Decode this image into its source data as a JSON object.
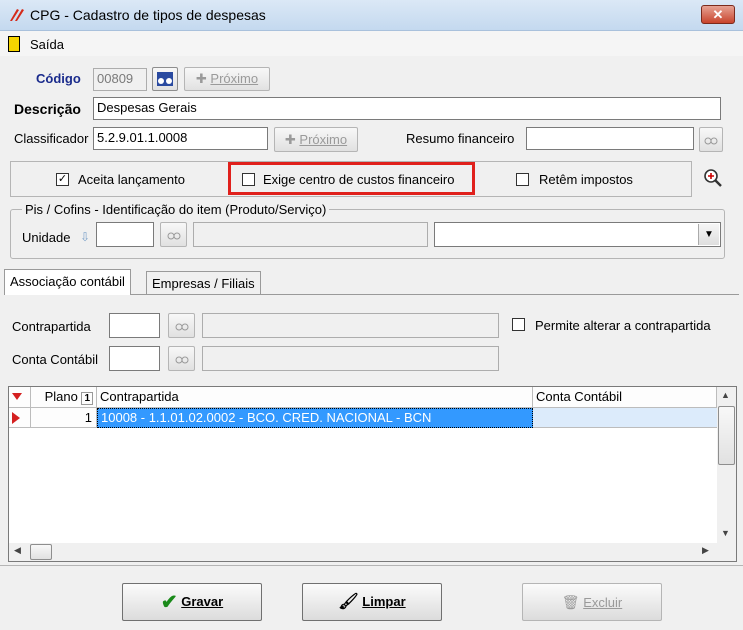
{
  "window": {
    "title": "CPG - Cadastro de tipos de despesas",
    "close_label": "✕"
  },
  "menu": {
    "saida": "Saída"
  },
  "form": {
    "codigo_label": "Código",
    "codigo_value": "00809",
    "proximo_label": "Próximo",
    "descricao_label": "Descrição",
    "descricao_value": "Despesas Gerais",
    "classificador_label": "Classificador",
    "classificador_value": "5.2.9.01.1.0008",
    "resumo_label": "Resumo financeiro",
    "resumo_value": ""
  },
  "options": {
    "aceita_label": "Aceita lançamento",
    "aceita_checked": "✓",
    "exige_label": "Exige centro de custos financeiro",
    "retem_label": "Retêm impostos"
  },
  "pis": {
    "group_title": "Pis / Cofins - Identificação do item (Produto/Serviço)",
    "unidade_label": "Unidade"
  },
  "tabs": [
    {
      "label": "Associação contábil"
    },
    {
      "label": "Empresas / Filiais"
    }
  ],
  "assoc": {
    "contrapartida_label": "Contrapartida",
    "conta_label": "Conta Contábil",
    "permite_label": "Permite alterar a contrapartida"
  },
  "table": {
    "columns": [
      "Plano",
      "Contrapartida",
      "Conta Contábil"
    ],
    "sort_indicator": "1",
    "rows": [
      {
        "plano": "1",
        "contrapartida": "10008 - 1.1.01.02.0002 - BCO. CRED. NACIONAL - BCN",
        "conta": ""
      }
    ]
  },
  "buttons": {
    "gravar": "Gravar",
    "limpar": "Limpar",
    "excluir": "Excluir"
  },
  "colors": {
    "highlight": "#e0201c",
    "selection": "#3399ff"
  }
}
